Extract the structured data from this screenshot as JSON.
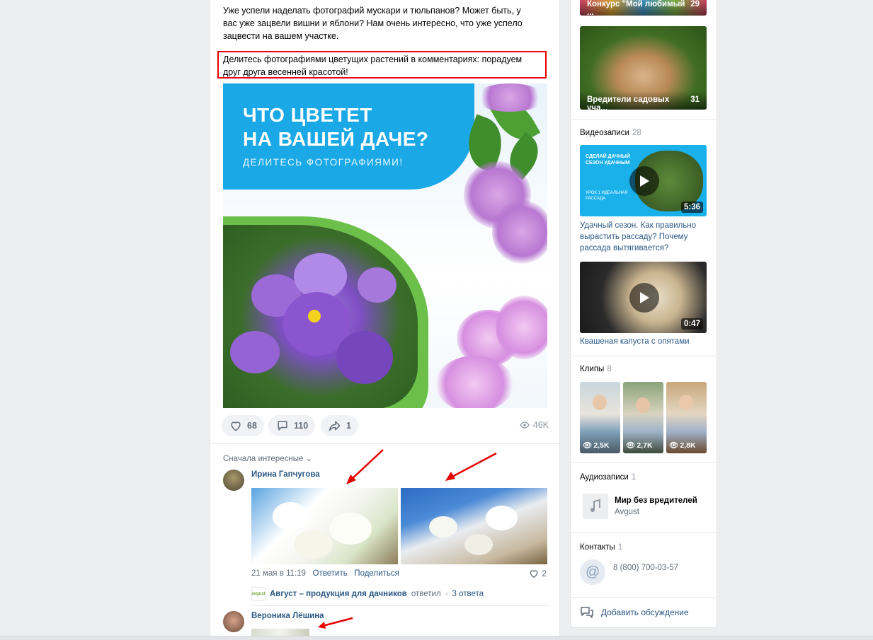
{
  "post": {
    "text_line1": "Уже успели наделать фотографий мускари и тюльпанов? Может быть, у вас уже зацвели вишни и яблони? Нам очень интересно, что уже успело зацвести на вашем участке.",
    "text_highlighted": "Делитесь фотографиями цветущих растений в комментариях: порадуем друг друга весенней красотой!",
    "image_title_line1": "ЧТО ЦВЕТЕТ",
    "image_title_line2": "НА ВАШЕЙ ДАЧЕ?",
    "image_subtitle": "ДЕЛИТЕСЬ ФОТОГРАФИЯМИ!",
    "likes": "68",
    "comments": "110",
    "shares": "1",
    "views": "46K",
    "colors": {
      "highlight_border": "#e60000",
      "banner": "#1aa8e6",
      "accent_link": "#2a5885"
    }
  },
  "comments": {
    "sort_label": "Сначала интересные",
    "items": [
      {
        "author": "Ирина Гапчугова",
        "date": "21 мая в 11:19",
        "reply_label": "Ответить",
        "share_label": "Поделиться",
        "likes": "2",
        "reply_author": "Август – продукция для дачников",
        "reply_verb": "ответил",
        "reply_count": "3 ответа"
      },
      {
        "author": "Вероника Лёшина"
      }
    ]
  },
  "sidebar": {
    "albums": [
      {
        "title": "Конкурс \"Мой любимый ...",
        "count": "29"
      },
      {
        "title": "Вредители садовых уча...",
        "count": "31"
      }
    ],
    "videos": {
      "heading": "Видеозаписи",
      "count": "28",
      "items": [
        {
          "title": "Удачный сезон. Как правильно вырастить рассаду? Почему рассада вытягивается?",
          "duration": "5:36",
          "thumb_text": "СДЕЛАЙ ДАЧНЫЙ СЕЗОН УДАЧНЫМ",
          "thumb_sub": "УРОК 1 ИДЕАЛЬНАЯ РАССАДА"
        },
        {
          "title": "Квашеная капуста с опятами",
          "duration": "0:47"
        }
      ]
    },
    "clips": {
      "heading": "Клипы",
      "count": "8",
      "items": [
        {
          "views": "2,5K"
        },
        {
          "views": "2,7K"
        },
        {
          "views": "2,8K"
        }
      ]
    },
    "audio": {
      "heading": "Аудиозаписи",
      "count": "1",
      "title": "Мир без вредителей",
      "artist": "Avgust"
    },
    "contacts": {
      "heading": "Контакты",
      "count": "1",
      "phone": "8 (800) 700-03-57"
    },
    "discussion_label": "Добавить обсуждение"
  }
}
